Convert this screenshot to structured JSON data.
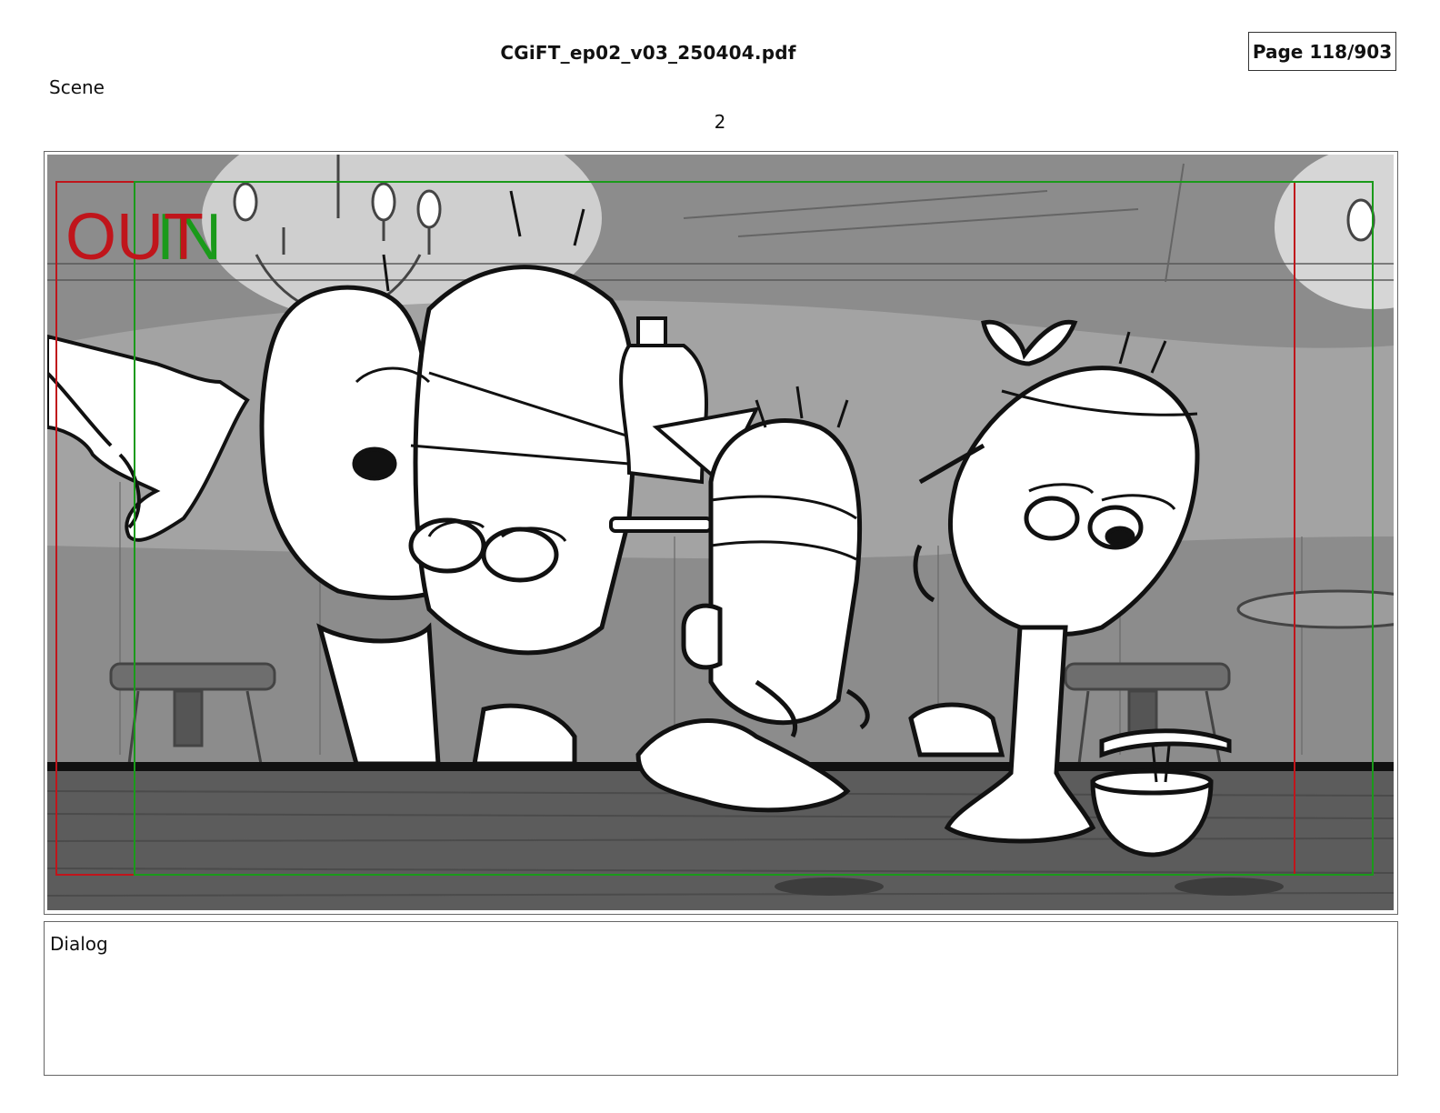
{
  "header": {
    "title": "CGiFT_ep02_v03_250404.pdf",
    "page": "Page 118/903"
  },
  "scene": {
    "label": "Scene",
    "number": "2"
  },
  "panel": {
    "safe_in_text": "IN",
    "safe_out_text": "OUT",
    "colors": {
      "out_frame": "#c0151b",
      "in_frame": "#1a9a1a",
      "background": "#8a8a8a",
      "table": "#5a5a5a"
    }
  },
  "dialog": {
    "label": "Dialog",
    "text": ""
  }
}
